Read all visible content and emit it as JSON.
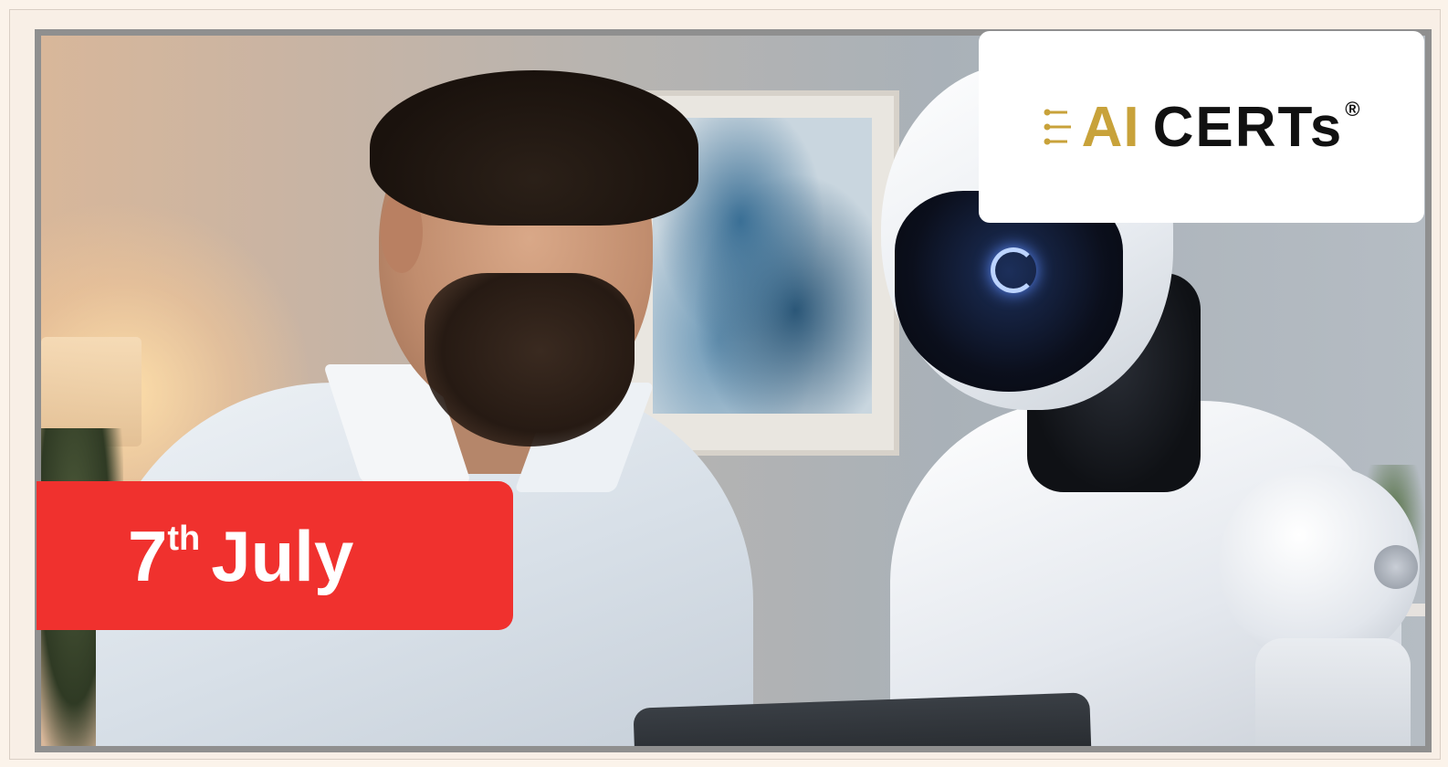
{
  "logo": {
    "ai_text": "AI",
    "certs_text": "CERTs",
    "registered_mark": "®",
    "ai_color": "#c8a23a",
    "certs_color": "#111111"
  },
  "date_badge": {
    "day": "7",
    "suffix": "th",
    "month": "July",
    "background_color": "#f0312e"
  },
  "scene": {
    "icons": [
      "circuit-logo-icon"
    ]
  }
}
